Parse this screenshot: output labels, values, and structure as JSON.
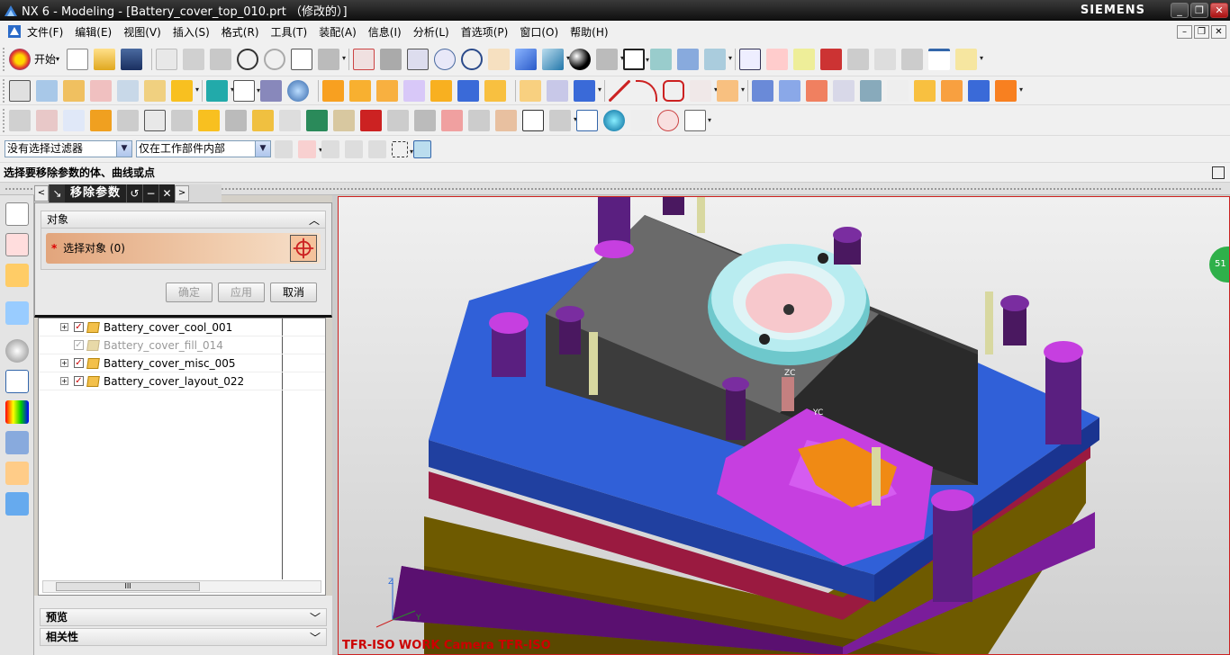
{
  "window": {
    "title": "NX 6 - Modeling - [Battery_cover_top_010.prt （修改的）]",
    "brand": "SIEMENS",
    "controls": [
      "_",
      "❐",
      "✕"
    ]
  },
  "menu": {
    "items": [
      "文件(F)",
      "编辑(E)",
      "视图(V)",
      "插入(S)",
      "格式(R)",
      "工具(T)",
      "装配(A)",
      "信息(I)",
      "分析(L)",
      "首选项(P)",
      "窗口(O)",
      "帮助(H)"
    ]
  },
  "toolbar": {
    "start_label": "开始"
  },
  "filters": {
    "type_filter": "没有选择过滤器",
    "scope_filter": "仅在工作部件内部"
  },
  "cue": {
    "text": "选择要移除参数的体、曲线或点"
  },
  "dialog": {
    "title": "移除参数",
    "section_object": "对象",
    "select_label": "选择对象 (0)",
    "ok": "确定",
    "apply": "应用",
    "cancel": "取消",
    "section_preview": "预览",
    "section_dependencies": "相关性"
  },
  "navigator": {
    "rows": [
      {
        "label": "Battery_cover_cool_001",
        "checked": true,
        "greyed": false,
        "expandable": true
      },
      {
        "label": "Battery_cover_fill_014",
        "checked": true,
        "greyed": true,
        "expandable": false
      },
      {
        "label": "Battery_cover_misc_005",
        "checked": true,
        "greyed": false,
        "expandable": true
      },
      {
        "label": "Battery_cover_layout_022",
        "checked": true,
        "greyed": false,
        "expandable": true
      }
    ],
    "scroll_grip": "III"
  },
  "viewport": {
    "status": "TFR-ISO WORK Camera TFR-ISO",
    "badge": "51",
    "axes": {
      "z": "Z",
      "y": "Y",
      "zc": "ZC",
      "yc": "YC"
    }
  }
}
